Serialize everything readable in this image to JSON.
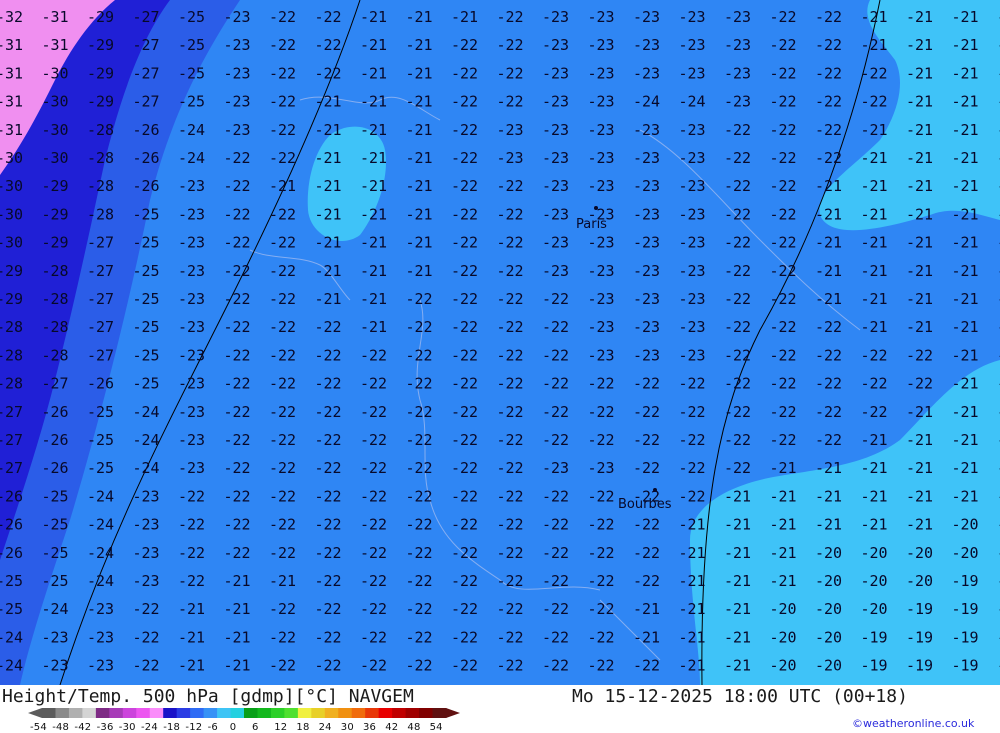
{
  "title": "Height/Temp. 500 hPa [gdmp][°C] NAVGEM",
  "valid_time": "Mo 15-12-2025 18:00 UTC (00+18)",
  "credit": "©weatheronline.co.uk",
  "cities": [
    "Paris",
    "Bourbes"
  ],
  "colorbar": {
    "labels": [
      "-54",
      "-48",
      "-42",
      "-36",
      "-30",
      "-24",
      "-18",
      "-12",
      "-6",
      "0",
      "6",
      "12",
      "18",
      "24",
      "30",
      "36",
      "42",
      "48",
      "54"
    ],
    "colors": [
      "#5c5c5c",
      "#8a8a8a",
      "#b0b0b0",
      "#d4d4d4",
      "#7e2b85",
      "#a73bb8",
      "#cc44dc",
      "#ec56f0",
      "#fa8cfa",
      "#1a12c8",
      "#2b3de4",
      "#2f6cf5",
      "#3792f6",
      "#3fc4f5",
      "#24d0e0",
      "#08a018",
      "#14b81e",
      "#2cd028",
      "#50e030",
      "#f0f040",
      "#e8d028",
      "#f0b020",
      "#f09010",
      "#f06c0c",
      "#e83808",
      "#e80000",
      "#c00000",
      "#a00000",
      "#800000",
      "#601010"
    ]
  },
  "temperatures": {
    "rows": [
      [
        "-32",
        "-31",
        "-29",
        "-27",
        "-25",
        "-23",
        "-22",
        "-22",
        "-21",
        "-21",
        "-21",
        "-22",
        "-23",
        "-23",
        "-23",
        "-23",
        "-23",
        "-22",
        "-22",
        "-21",
        "-21",
        "-21",
        "-20"
      ],
      [
        "-31",
        "-31",
        "-29",
        "-27",
        "-25",
        "-23",
        "-22",
        "-22",
        "-21",
        "-21",
        "-22",
        "-22",
        "-23",
        "-23",
        "-23",
        "-23",
        "-23",
        "-22",
        "-22",
        "-21",
        "-21",
        "-21",
        "-20"
      ],
      [
        "-31",
        "-30",
        "-29",
        "-27",
        "-25",
        "-23",
        "-22",
        "-22",
        "-21",
        "-21",
        "-22",
        "-22",
        "-23",
        "-23",
        "-23",
        "-23",
        "-23",
        "-22",
        "-22",
        "-22",
        "-21",
        "-21",
        "-20"
      ],
      [
        "-31",
        "-30",
        "-29",
        "-27",
        "-25",
        "-23",
        "-22",
        "-21",
        "-21",
        "-21",
        "-22",
        "-22",
        "-23",
        "-23",
        "-24",
        "-24",
        "-23",
        "-22",
        "-22",
        "-22",
        "-21",
        "-21",
        "-20"
      ],
      [
        "-31",
        "-30",
        "-28",
        "-26",
        "-24",
        "-23",
        "-22",
        "-21",
        "-21",
        "-21",
        "-22",
        "-23",
        "-23",
        "-23",
        "-23",
        "-23",
        "-22",
        "-22",
        "-22",
        "-21",
        "-21",
        "-21",
        "-21"
      ],
      [
        "-30",
        "-30",
        "-28",
        "-26",
        "-24",
        "-22",
        "-22",
        "-21",
        "-21",
        "-21",
        "-22",
        "-23",
        "-23",
        "-23",
        "-23",
        "-23",
        "-22",
        "-22",
        "-22",
        "-21",
        "-21",
        "-21",
        "-21"
      ],
      [
        "-30",
        "-29",
        "-28",
        "-26",
        "-23",
        "-22",
        "-21",
        "-21",
        "-21",
        "-21",
        "-22",
        "-22",
        "-23",
        "-23",
        "-23",
        "-23",
        "-22",
        "-22",
        "-21",
        "-21",
        "-21",
        "-21",
        "-21"
      ],
      [
        "-30",
        "-29",
        "-28",
        "-25",
        "-23",
        "-22",
        "-22",
        "-21",
        "-21",
        "-21",
        "-22",
        "-22",
        "-23",
        "-23",
        "-23",
        "-23",
        "-22",
        "-22",
        "-21",
        "-21",
        "-21",
        "-21",
        "-21"
      ],
      [
        "-30",
        "-29",
        "-27",
        "-25",
        "-23",
        "-22",
        "-22",
        "-21",
        "-21",
        "-21",
        "-22",
        "-22",
        "-23",
        "-23",
        "-23",
        "-23",
        "-22",
        "-22",
        "-21",
        "-21",
        "-21",
        "-21",
        "-21"
      ],
      [
        "-29",
        "-28",
        "-27",
        "-25",
        "-23",
        "-22",
        "-22",
        "-21",
        "-21",
        "-21",
        "-22",
        "-22",
        "-23",
        "-23",
        "-23",
        "-23",
        "-22",
        "-22",
        "-21",
        "-21",
        "-21",
        "-21",
        "-21"
      ],
      [
        "-29",
        "-28",
        "-27",
        "-25",
        "-23",
        "-22",
        "-22",
        "-21",
        "-21",
        "-22",
        "-22",
        "-22",
        "-22",
        "-23",
        "-23",
        "-23",
        "-22",
        "-22",
        "-21",
        "-21",
        "-21",
        "-21",
        "-21"
      ],
      [
        "-28",
        "-28",
        "-27",
        "-25",
        "-23",
        "-22",
        "-22",
        "-22",
        "-21",
        "-22",
        "-22",
        "-22",
        "-22",
        "-23",
        "-23",
        "-23",
        "-22",
        "-22",
        "-22",
        "-21",
        "-21",
        "-21",
        "-21"
      ],
      [
        "-28",
        "-28",
        "-27",
        "-25",
        "-23",
        "-22",
        "-22",
        "-22",
        "-22",
        "-22",
        "-22",
        "-22",
        "-22",
        "-23",
        "-23",
        "-23",
        "-22",
        "-22",
        "-22",
        "-22",
        "-22",
        "-21",
        "-21"
      ],
      [
        "-28",
        "-27",
        "-26",
        "-25",
        "-23",
        "-22",
        "-22",
        "-22",
        "-22",
        "-22",
        "-22",
        "-22",
        "-22",
        "-22",
        "-22",
        "-22",
        "-22",
        "-22",
        "-22",
        "-22",
        "-22",
        "-21",
        "-21"
      ],
      [
        "-27",
        "-26",
        "-25",
        "-24",
        "-23",
        "-22",
        "-22",
        "-22",
        "-22",
        "-22",
        "-22",
        "-22",
        "-22",
        "-22",
        "-22",
        "-22",
        "-22",
        "-22",
        "-22",
        "-22",
        "-21",
        "-21",
        "-21"
      ],
      [
        "-27",
        "-26",
        "-25",
        "-24",
        "-23",
        "-22",
        "-22",
        "-22",
        "-22",
        "-22",
        "-22",
        "-22",
        "-22",
        "-22",
        "-22",
        "-22",
        "-22",
        "-22",
        "-22",
        "-21",
        "-21",
        "-21",
        "-21"
      ],
      [
        "-27",
        "-26",
        "-25",
        "-24",
        "-23",
        "-22",
        "-22",
        "-22",
        "-22",
        "-22",
        "-22",
        "-22",
        "-23",
        "-23",
        "-22",
        "-22",
        "-22",
        "-21",
        "-21",
        "-21",
        "-21",
        "-21",
        "-20"
      ],
      [
        "-26",
        "-25",
        "-24",
        "-23",
        "-22",
        "-22",
        "-22",
        "-22",
        "-22",
        "-22",
        "-22",
        "-22",
        "-22",
        "-22",
        "-22",
        "-22",
        "-21",
        "-21",
        "-21",
        "-21",
        "-21",
        "-21",
        "-20"
      ],
      [
        "-26",
        "-25",
        "-24",
        "-23",
        "-22",
        "-22",
        "-22",
        "-22",
        "-22",
        "-22",
        "-22",
        "-22",
        "-22",
        "-22",
        "-22",
        "-21",
        "-21",
        "-21",
        "-21",
        "-21",
        "-21",
        "-20",
        "-20"
      ],
      [
        "-26",
        "-25",
        "-24",
        "-23",
        "-22",
        "-22",
        "-22",
        "-22",
        "-22",
        "-22",
        "-22",
        "-22",
        "-22",
        "-22",
        "-22",
        "-21",
        "-21",
        "-21",
        "-20",
        "-20",
        "-20",
        "-20",
        "-19"
      ],
      [
        "-25",
        "-25",
        "-24",
        "-23",
        "-22",
        "-21",
        "-21",
        "-22",
        "-22",
        "-22",
        "-22",
        "-22",
        "-22",
        "-22",
        "-22",
        "-21",
        "-21",
        "-21",
        "-20",
        "-20",
        "-20",
        "-19",
        "-19"
      ],
      [
        "-25",
        "-24",
        "-23",
        "-22",
        "-21",
        "-21",
        "-22",
        "-22",
        "-22",
        "-22",
        "-22",
        "-22",
        "-22",
        "-22",
        "-21",
        "-21",
        "-21",
        "-20",
        "-20",
        "-20",
        "-19",
        "-19",
        "-19"
      ],
      [
        "-24",
        "-23",
        "-23",
        "-22",
        "-21",
        "-21",
        "-22",
        "-22",
        "-22",
        "-22",
        "-22",
        "-22",
        "-22",
        "-22",
        "-21",
        "-21",
        "-21",
        "-20",
        "-20",
        "-19",
        "-19",
        "-19",
        "-19"
      ],
      [
        "-24",
        "-23",
        "-23",
        "-22",
        "-21",
        "-21",
        "-22",
        "-22",
        "-22",
        "-22",
        "-22",
        "-22",
        "-22",
        "-22",
        "-22",
        "-21",
        "-21",
        "-20",
        "-20",
        "-19",
        "-19",
        "-19",
        "-19"
      ]
    ]
  }
}
